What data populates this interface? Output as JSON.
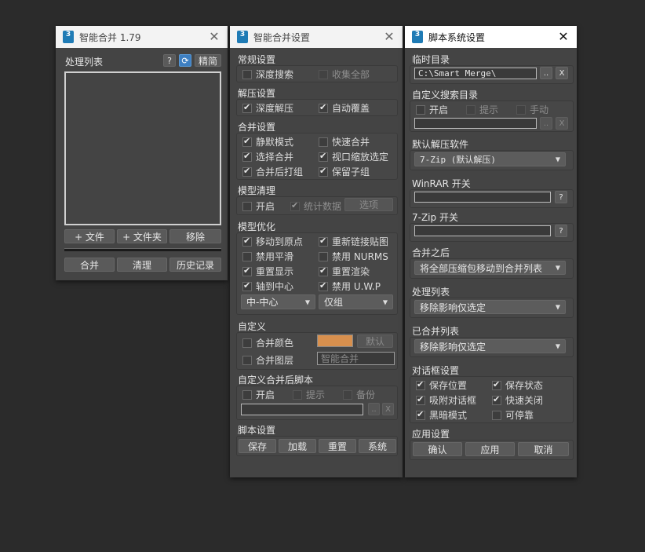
{
  "win1": {
    "title": "智能合并 1.79",
    "list_label": "处理列表",
    "help": "?",
    "refresh_icon": "refresh-icon",
    "simplify": "精简",
    "add_file": "+ 文件",
    "add_folder": "+ 文件夹",
    "remove": "移除",
    "merge": "合并",
    "clear": "清理",
    "history": "历史记录"
  },
  "win2": {
    "title": "智能合并设置",
    "general": {
      "label": "常规设置",
      "deep_search": "深度搜索",
      "collect_all": "收集全部"
    },
    "extract": {
      "label": "解压设置",
      "deep_extract": "深度解压",
      "auto_overwrite": "自动覆盖"
    },
    "merge": {
      "label": "合并设置",
      "silent": "静默模式",
      "quick": "快速合并",
      "select_merge": "选择合并",
      "viewport_zoom": "视口缩放选定",
      "group_after": "合并后打组",
      "keep_child": "保留子组"
    },
    "clean": {
      "label": "模型清理",
      "enable": "开启",
      "stats": "统计数据",
      "options": "选项"
    },
    "optimize": {
      "label": "模型优化",
      "move_origin": "移动到原点",
      "relink_maps": "重新链接贴图",
      "disable_smooth": "禁用平滑",
      "disable_nurms": "禁用 NURMS",
      "reset_display": "重置显示",
      "reset_render": "重置渲染",
      "pivot_center": "轴到中心",
      "disable_uwp": "禁用 U.W.P",
      "pivot_sel": "中-中心",
      "group_sel": "仅组"
    },
    "custom": {
      "label": "自定义",
      "merge_color": "合并颜色",
      "default": "默认",
      "merge_layer": "合并图层",
      "layer_name": "智能合并"
    },
    "post_script": {
      "label": "自定义合并后脚本",
      "enable": "开启",
      "prompt": "提示",
      "backup": "备份",
      "browse": "..",
      "clear": "X"
    },
    "script": {
      "label": "脚本设置",
      "save": "保存",
      "load": "加载",
      "reset": "重置",
      "system": "系统"
    }
  },
  "win3": {
    "title": "脚本系统设置",
    "temp": {
      "label": "临时目录",
      "path": "C:\\Smart Merge\\",
      "browse": "..",
      "clear": "X"
    },
    "custom_search": {
      "label": "自定义搜索目录",
      "enable": "开启",
      "prompt": "提示",
      "manual": "手动",
      "browse": "..",
      "clear": "X"
    },
    "default_extract": {
      "label": "默认解压软件",
      "value": "7-Zip (默认解压)"
    },
    "winrar": {
      "label": "WinRAR 开关",
      "help": "?"
    },
    "sevenzip": {
      "label": "7-Zip 开关",
      "help": "?"
    },
    "after_merge": {
      "label": "合并之后",
      "value": "将全部压缩包移动到合并列表"
    },
    "process_list": {
      "label": "处理列表",
      "value": "移除影响仅选定"
    },
    "merged_list": {
      "label": "已合并列表",
      "value": "移除影响仅选定"
    },
    "dialog": {
      "label": "对话框设置",
      "save_pos": "保存位置",
      "save_state": "保存状态",
      "snap": "吸附对话框",
      "quick_close": "快速关闭",
      "dark": "黑暗模式",
      "dockable": "可停靠"
    },
    "apply": {
      "label": "应用设置",
      "ok": "确认",
      "apply": "应用",
      "cancel": "取消"
    }
  },
  "colors": {
    "merge_color": "#d8904e",
    "accent_blue": "#1f7bb5"
  }
}
